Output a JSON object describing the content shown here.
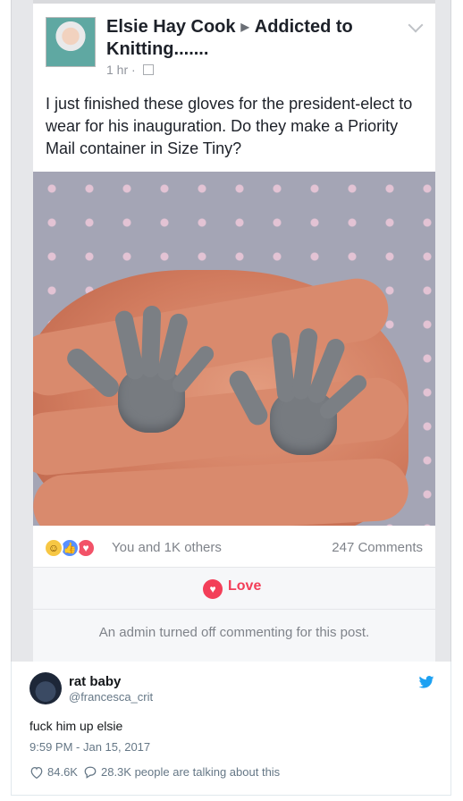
{
  "facebook_post": {
    "author": "Elsie Hay Cook",
    "group": "Addicted to Knitting.......",
    "time": "1 hr",
    "separator": "·",
    "text": "I just finished these gloves for the president-elect to wear for his inauguration. Do they make a Priority Mail container in Size Tiny?",
    "reactions_summary": "You and 1K others",
    "comments_count": "247 Comments",
    "love_label": "Love",
    "admin_note": "An admin turned off commenting for this post."
  },
  "tweet": {
    "display_name": "rat baby",
    "handle": "@francesca_crit",
    "text": "fuck him up elsie",
    "timestamp": "9:59 PM - Jan 15, 2017",
    "likes": "84.6K",
    "replies": "28.3K people are talking about this"
  },
  "colors": {
    "love_red": "#f33e58",
    "twitter_blue": "#1da1f2",
    "like_blue": "#5890ff",
    "haha_yellow": "#f7c744"
  },
  "icons": [
    "haha-reaction-icon",
    "like-reaction-icon",
    "love-reaction-icon",
    "twitter-bird-icon",
    "heart-outline-icon",
    "reply-bubble-icon",
    "globe-icon",
    "chevron-down-icon"
  ]
}
